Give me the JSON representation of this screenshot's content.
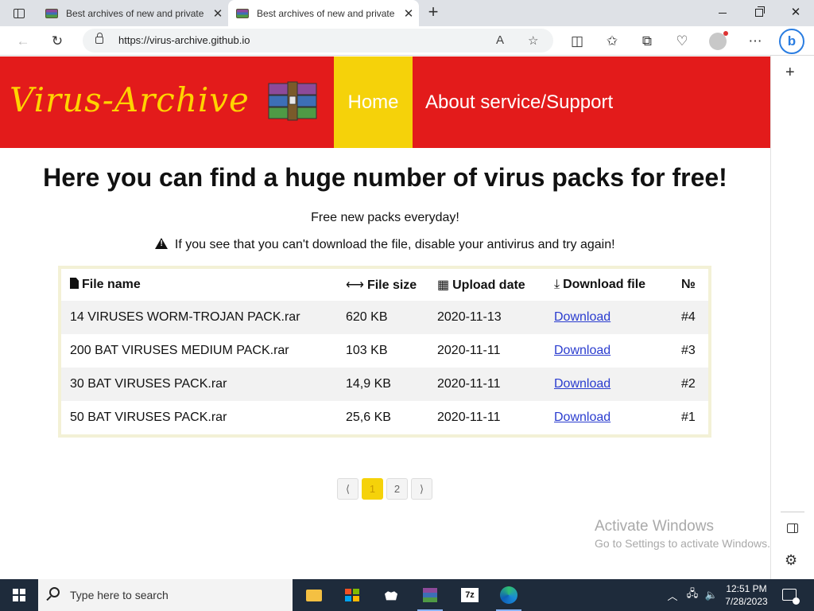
{
  "browser": {
    "tabs": [
      {
        "title": "Best archives of new and private",
        "active": false
      },
      {
        "title": "Best archives of new and private",
        "active": true
      }
    ],
    "new_tab_symbol": "+",
    "address": "https://virus-archive.github.io"
  },
  "site": {
    "logo_text": "Virus-Archive",
    "nav": {
      "home": "Home",
      "about": "About service/Support"
    },
    "headline": "Here you can find a huge number of virus packs for free!",
    "subtitle": "Free new packs everyday!",
    "warning": "If you see that you can't download the file, disable your antivirus and try again!",
    "table": {
      "headers": {
        "file_name": "File name",
        "file_size": "File size",
        "upload_date": "Upload date",
        "download": "Download file",
        "number": "№"
      },
      "rows": [
        {
          "name": "14 VIRUSES WORM-TROJAN PACK.rar",
          "size": "620 KB",
          "date": "2020-11-13",
          "link": "Download",
          "num": "#4"
        },
        {
          "name": "200 BAT VIRUSES MEDIUM PACK.rar",
          "size": "103 KB",
          "date": "2020-11-11",
          "link": "Download",
          "num": "#3"
        },
        {
          "name": "30 BAT VIRUSES PACK.rar",
          "size": "14,9 KB",
          "date": "2020-11-11",
          "link": "Download",
          "num": "#2"
        },
        {
          "name": "50 BAT VIRUSES PACK.rar",
          "size": "25,6 KB",
          "date": "2020-11-11",
          "link": "Download",
          "num": "#1"
        }
      ]
    },
    "pagination": {
      "prev": "⟨",
      "pages": [
        "1",
        "2"
      ],
      "next": "⟩",
      "current": "1"
    }
  },
  "watermark": {
    "line1": "Activate Windows",
    "line2": "Go to Settings to activate Windows."
  },
  "taskbar": {
    "search_placeholder": "Type here to search",
    "time": "12:51 PM",
    "date": "7/28/2023"
  },
  "colors": {
    "header_red": "#e31b1b",
    "accent_yellow": "#f5d20a",
    "logo_yellow": "#ffd400",
    "link_blue": "#2a3ccf"
  }
}
